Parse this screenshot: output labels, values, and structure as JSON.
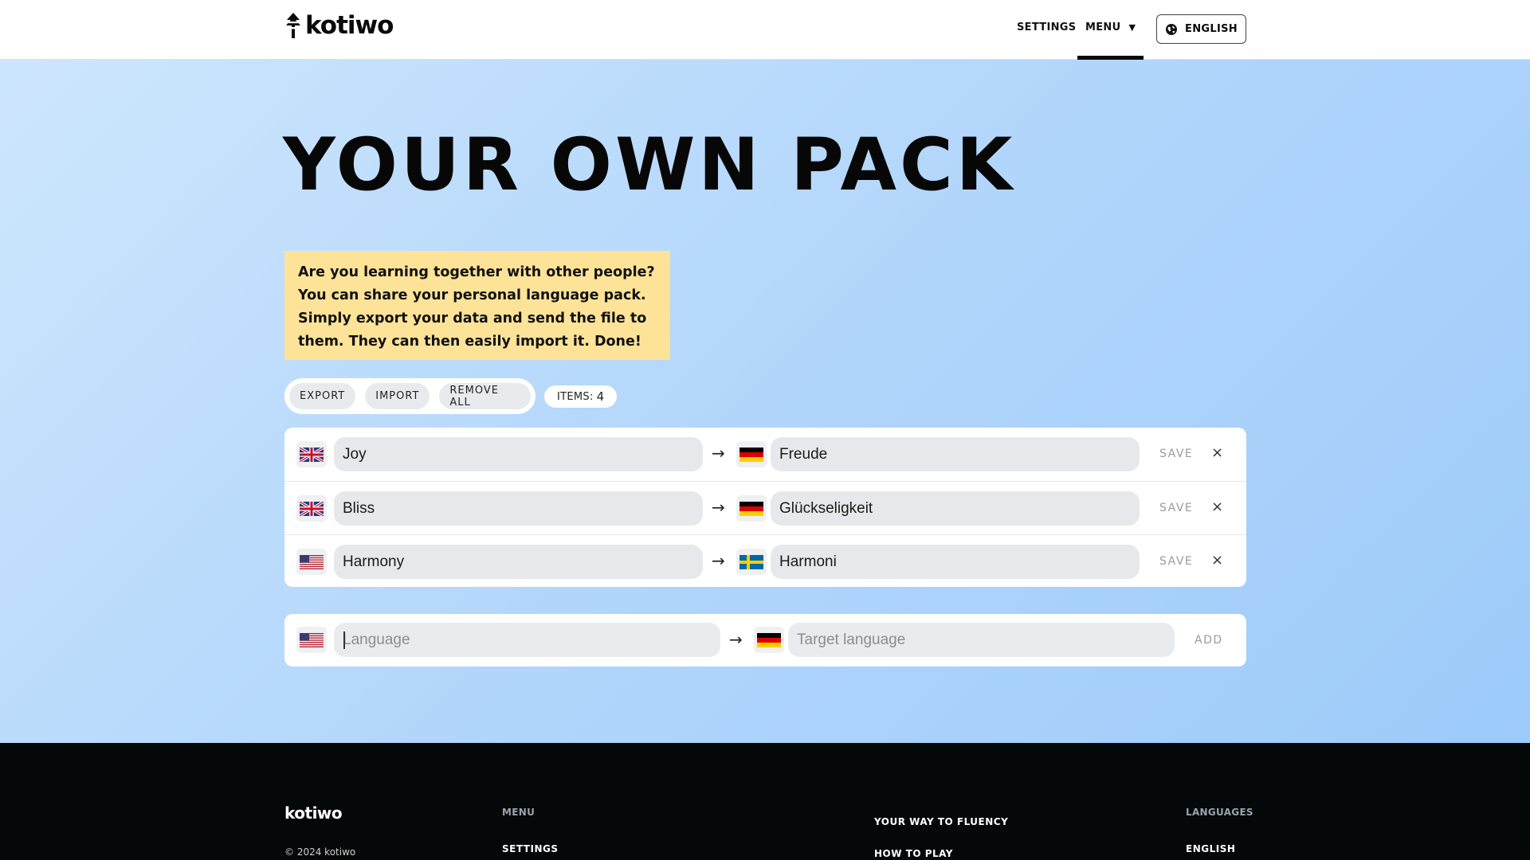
{
  "header": {
    "logo_text": "kotiwo",
    "nav": {
      "settings": "SETTINGS",
      "menu": "MENU",
      "menu_caret": "▼"
    },
    "language_button": "ENGLISH"
  },
  "page": {
    "title": "YOUR OWN PACK",
    "info": "Are you learning together with other people? You can share your personal language pack. Simply export your data and send the file to them. They can then easily import it. Done!"
  },
  "actions": {
    "export": "EXPORT",
    "import": "IMPORT",
    "remove_all": "REMOVE ALL",
    "items_label": "ITEMS:",
    "items_count": "4"
  },
  "pairs": [
    {
      "source_flag": "uk-flag",
      "source": "Joy",
      "target_flag": "germany-flag",
      "target": "Freude",
      "save": "SAVE",
      "remove": "×"
    },
    {
      "source_flag": "uk-flag",
      "source": "Bliss",
      "target_flag": "germany-flag",
      "target": "Glückseligkeit",
      "save": "SAVE",
      "remove": "×"
    },
    {
      "source_flag": "us-flag",
      "source": "Harmony",
      "target_flag": "sweden-flag",
      "target": "Harmoni",
      "save": "SAVE",
      "remove": "×"
    }
  ],
  "arrow": "→",
  "new_pair": {
    "source_flag": "us-flag",
    "source_placeholder": "Language",
    "target_flag": "germany-flag",
    "target_placeholder": "Target language",
    "add": "ADD"
  },
  "footer": {
    "logo": "kotiwo",
    "copyright": "© 2024 kotiwo",
    "menu_heading": "MENU",
    "menu_link": "SETTINGS",
    "links": [
      "YOUR WAY TO FLUENCY",
      "HOW TO PLAY"
    ],
    "languages_heading": "LANGUAGES",
    "language_link": "ENGLISH"
  },
  "colors": {
    "info_background": "#fde398",
    "footer_background": "#050808",
    "hero_gradient_start": "#cde6fd",
    "hero_gradient_end": "#9dcbfa"
  }
}
